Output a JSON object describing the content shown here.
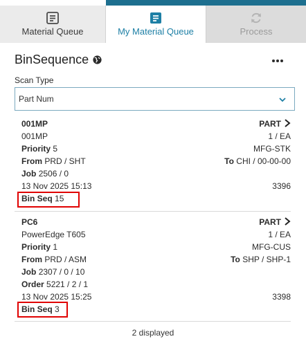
{
  "tabs": [
    {
      "label": "Material Queue",
      "icon": "list-icon",
      "state": "inactive"
    },
    {
      "label": "My Material Queue",
      "icon": "list-icon",
      "state": "active"
    },
    {
      "label": "Process",
      "icon": "refresh-icon",
      "state": "disabled"
    }
  ],
  "header": {
    "title": "BinSequence",
    "globe_icon": "globe-icon",
    "menu_icon": "more-icon"
  },
  "scan": {
    "label": "Scan Type",
    "value": "Part Num"
  },
  "cards": [
    {
      "part": "001MP",
      "description": "001MP",
      "part_label": "PART",
      "qty": "1 / EA",
      "priority_label": "Priority",
      "priority": "5",
      "class": "MFG-STK",
      "from_label": "From",
      "from": "PRD / SHT",
      "to_label": "To",
      "to": "CHI / 00-00-00",
      "job_label": "Job",
      "job": "2506 / 0",
      "date": "13 Nov 2025 15:13",
      "id": "3396",
      "binseq_label": "Bin Seq",
      "binseq": "15"
    },
    {
      "part": "PC6",
      "description": "PowerEdge T605",
      "part_label": "PART",
      "qty": "1 / EA",
      "priority_label": "Priority",
      "priority": "1",
      "class": "MFG-CUS",
      "from_label": "From",
      "from": "PRD / ASM",
      "to_label": "To",
      "to": "SHP / SHP-1",
      "job_label": "Job",
      "job": "2307 / 0 / 10",
      "order_label": "Order",
      "order": "5221 / 2 / 1",
      "date": "13 Nov 2025 15:25",
      "id": "3398",
      "binseq_label": "Bin Seq",
      "binseq": "3"
    }
  ],
  "footer": {
    "count_text": "2 displayed"
  },
  "colors": {
    "accent": "#1d6f8f",
    "active_tab_text": "#1d7fa5",
    "highlight": "#e00000"
  }
}
